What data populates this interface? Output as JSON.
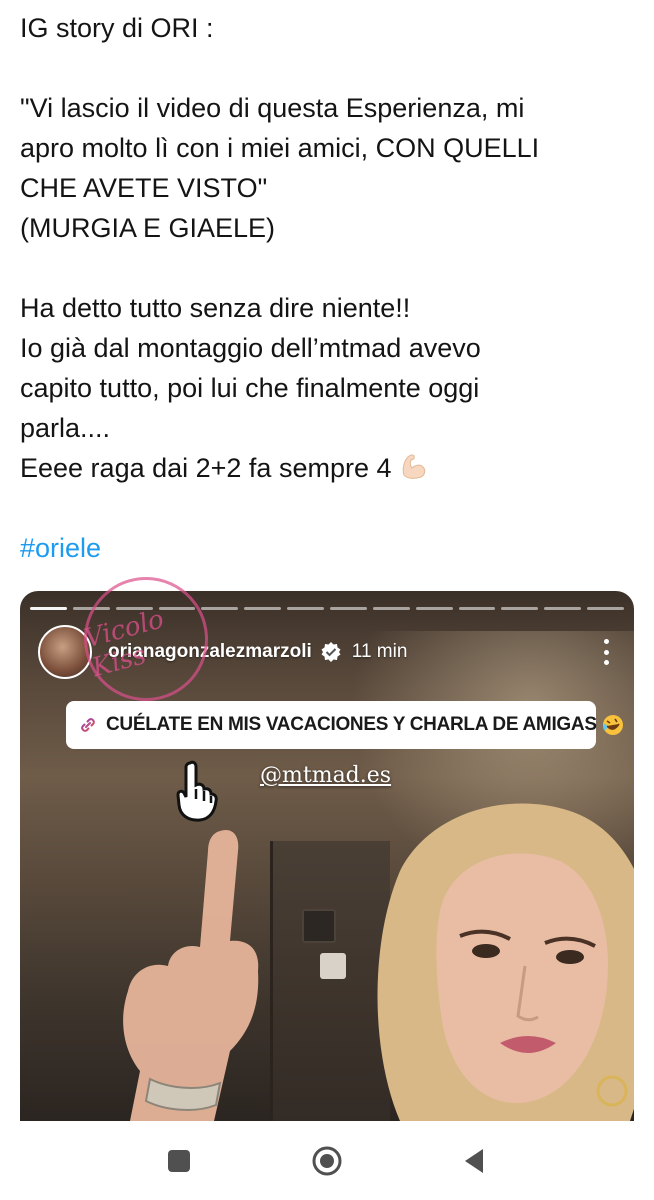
{
  "tweet": {
    "lines": [
      "IG story di  ORI :",
      "",
      "\"Vi lascio il video di questa Esperienza, mi",
      "apro molto lì con i miei amici, CON QUELLI",
      "CHE AVETE VISTO\"",
      "(MURGIA E GIAELE)",
      "",
      "Ha detto tutto senza dire niente!!",
      "Io già dal montaggio dell’mtmad avevo",
      "capito tutto, poi lui che finalmente oggi",
      "parla....",
      "Eeee raga dai 2+2 fa sempre 4"
    ],
    "emoji": "flexed-biceps-icon",
    "hashtag": "#oriele"
  },
  "story": {
    "segments_total": 14,
    "segments_done": 1,
    "username": "orianagonzalezmarzoli",
    "verified": true,
    "time": "11 min",
    "sticker_text": "CUÉLATE EN MIS VACACIONES Y CHARLA DE AMIGAS",
    "mention": "@mtmad.es"
  },
  "watermark": {
    "text": "Vicolo Kiss",
    "color": "#dc508c"
  },
  "navbar": {
    "icons": [
      "recents-square-icon",
      "home-circle-icon",
      "back-triangle-icon"
    ]
  },
  "colors": {
    "hashtag": "#1d9bf0",
    "text": "#141414",
    "background": "#ffffff"
  }
}
